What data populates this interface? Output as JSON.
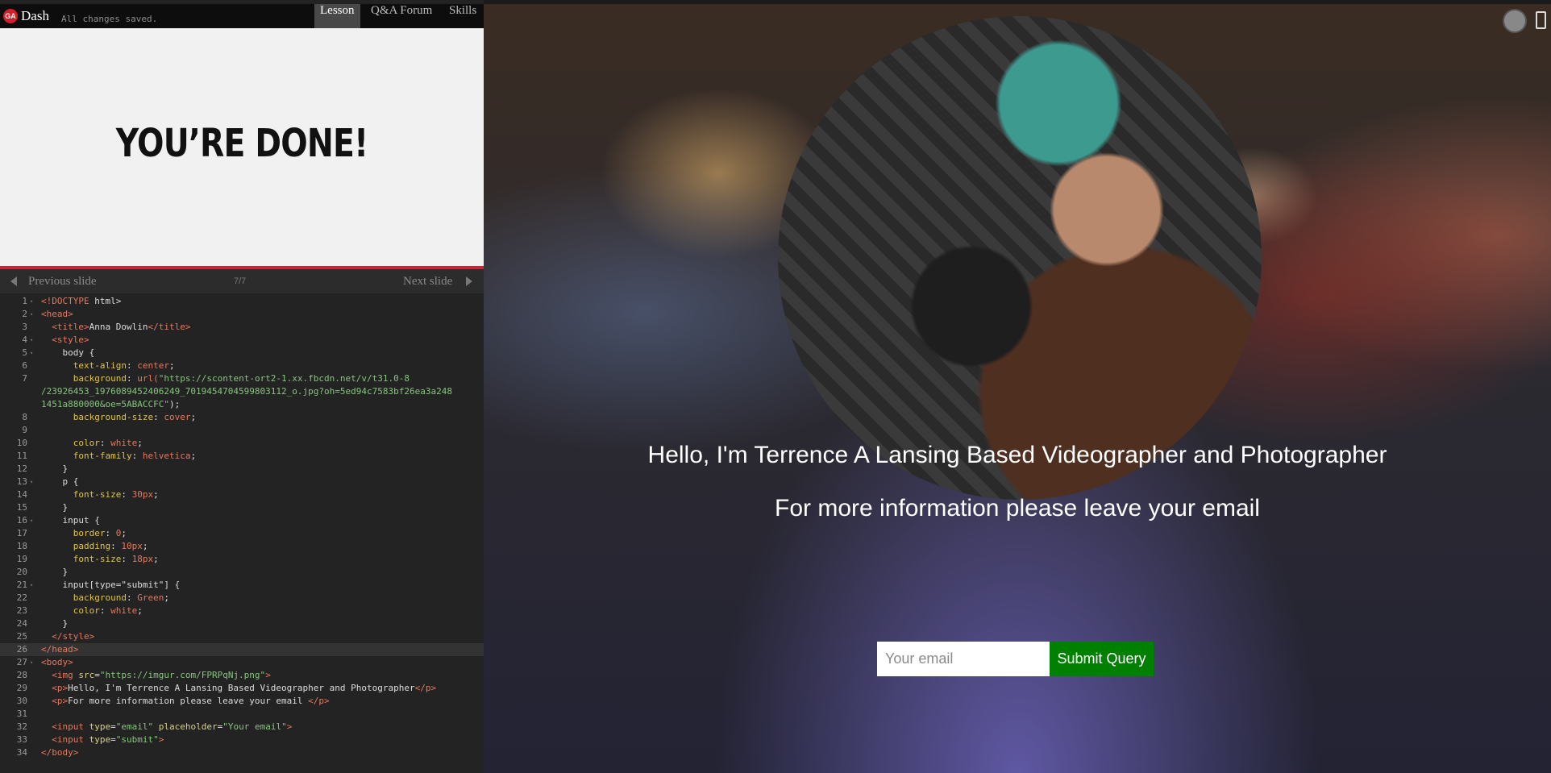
{
  "app": {
    "logo": "GA",
    "brand": "Dash",
    "save_status": "All changes saved."
  },
  "nav": {
    "tabs": [
      "Lesson",
      "Q&A Forum",
      "Skills"
    ],
    "active": "Lesson"
  },
  "slide": {
    "title": "YOU’RE DONE!"
  },
  "slide_nav": {
    "prev": "Previous slide",
    "counter": "7/7",
    "next": "Next slide"
  },
  "code_lines": [
    {
      "n": "1",
      "fold": true,
      "html": "<span class=\"tag\">&lt;!DOCTYPE</span> <span class=\"txt\">html&gt;</span>"
    },
    {
      "n": "2",
      "fold": true,
      "html": "<span class=\"tag\">&lt;head&gt;</span>"
    },
    {
      "n": "3",
      "html": "  <span class=\"tag\">&lt;title&gt;</span><span class=\"txt\">Anna Dowlin</span><span class=\"tag\">&lt;/title&gt;</span>"
    },
    {
      "n": "4",
      "fold": true,
      "html": "  <span class=\"tag\">&lt;style&gt;</span>"
    },
    {
      "n": "5",
      "fold": true,
      "html": "    <span class=\"sel\">body {</span>"
    },
    {
      "n": "6",
      "html": "      <span class=\"prop\">text-align</span>: <span class=\"val\">center</span>;"
    },
    {
      "n": "7",
      "wrap": true,
      "html": "      <span class=\"prop\">background</span>: <span class=\"val\">url(</span><span class=\"str\">\"https://scontent-ort2-1.xx.fbcdn.net/v/t31.0-8\n/23926453_1976089452406249_7019454704599803112_o.jpg?oh=5ed94c7583bf26ea3a248\n1451a880000&amp;oe=5ABACCFC\"</span>);"
    },
    {
      "n": "8",
      "html": "      <span class=\"prop\">background-size</span>: <span class=\"val\">cover</span>;"
    },
    {
      "n": "9",
      "html": ""
    },
    {
      "n": "10",
      "html": "      <span class=\"prop\">color</span>: <span class=\"val\">white</span>;"
    },
    {
      "n": "11",
      "html": "      <span class=\"prop\">font-family</span>: <span class=\"val\">helvetica</span>;"
    },
    {
      "n": "12",
      "html": "    }"
    },
    {
      "n": "13",
      "fold": true,
      "html": "    <span class=\"sel\">p {</span>"
    },
    {
      "n": "14",
      "html": "      <span class=\"prop\">font-size</span>: <span class=\"val\">30px</span>;"
    },
    {
      "n": "15",
      "html": "    }"
    },
    {
      "n": "16",
      "fold": true,
      "html": "    <span class=\"sel\">input {</span>"
    },
    {
      "n": "17",
      "html": "      <span class=\"prop\">border</span>: <span class=\"val\">0</span>;"
    },
    {
      "n": "18",
      "html": "      <span class=\"prop\">padding</span>: <span class=\"val\">10px</span>;"
    },
    {
      "n": "19",
      "html": "      <span class=\"prop\">font-size</span>: <span class=\"val\">18px</span>;"
    },
    {
      "n": "20",
      "html": "    }"
    },
    {
      "n": "21",
      "fold": true,
      "html": "    <span class=\"sel\">input[type=\"submit\"] {</span>"
    },
    {
      "n": "22",
      "html": "      <span class=\"prop\">background</span>: <span class=\"val\">Green</span>;"
    },
    {
      "n": "23",
      "html": "      <span class=\"prop\">color</span>: <span class=\"val\">white</span>;"
    },
    {
      "n": "24",
      "html": "    }"
    },
    {
      "n": "25",
      "html": "  <span class=\"tag\">&lt;/style&gt;</span>"
    },
    {
      "n": "26",
      "active": true,
      "html": "<span class=\"tag\">&lt;/head&gt;</span>"
    },
    {
      "n": "27",
      "fold": true,
      "html": "<span class=\"tag\">&lt;body&gt;</span>"
    },
    {
      "n": "28",
      "html": "  <span class=\"tag\">&lt;img</span> <span class=\"attr\">src</span>=<span class=\"str\">\"https://imgur.com/FPRPqNj.png\"</span><span class=\"tag\">&gt;</span>"
    },
    {
      "n": "29",
      "html": "  <span class=\"tag\">&lt;p&gt;</span><span class=\"txt\">Hello, I'm Terrence A Lansing Based Videographer and Photographer</span><span class=\"tag\">&lt;/p&gt;</span>"
    },
    {
      "n": "30",
      "html": "  <span class=\"tag\">&lt;p&gt;</span><span class=\"txt\">For more information please leave your email </span><span class=\"tag\">&lt;/p&gt;</span>"
    },
    {
      "n": "31",
      "html": ""
    },
    {
      "n": "32",
      "html": "  <span class=\"tag\">&lt;input</span> <span class=\"attr\">type</span>=<span class=\"str\">\"email\"</span> <span class=\"attr\">placeholder</span>=<span class=\"str\">\"Your email\"</span><span class=\"tag\">&gt;</span>"
    },
    {
      "n": "33",
      "html": "  <span class=\"tag\">&lt;input</span> <span class=\"attr\">type</span>=<span class=\"str\">\"submit\"</span><span class=\"tag\">&gt;</span>"
    },
    {
      "n": "34",
      "html": "<span class=\"tag\">&lt;/body&gt;</span>"
    }
  ],
  "preview": {
    "headline": "Hello, I'm Terrence A Lansing Based Videographer and Photographer",
    "subline": "For more information please leave your email",
    "email_placeholder": "Your email",
    "submit_label": "Submit Query",
    "submit_color": "#008000"
  },
  "preview_controls": {
    "toggle_icon": "circle-toggle-icon",
    "device_icon": "phone-icon"
  }
}
